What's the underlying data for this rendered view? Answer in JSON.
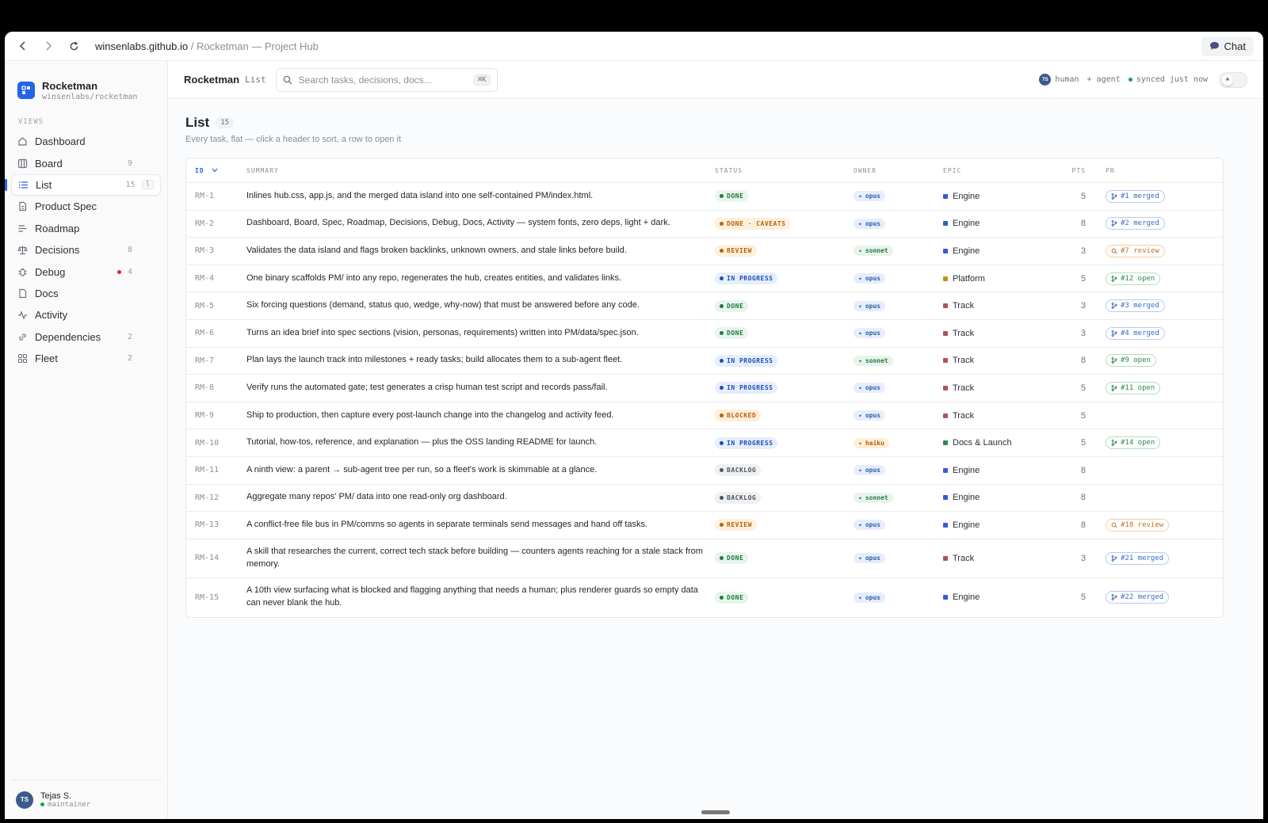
{
  "browser": {
    "host": "winsenlabs.github.io",
    "separator": "/",
    "title": "Rocketman — Project Hub",
    "chat_label": "Chat"
  },
  "sidebar": {
    "brand_name": "Rocketman",
    "brand_sub": "winsenlabs/rocketman",
    "views_label": "VIEWS",
    "items": [
      {
        "label": "Dashboard",
        "count": "",
        "icon": "home-icon"
      },
      {
        "label": "Board",
        "count": "9",
        "icon": "board-icon"
      },
      {
        "label": "List",
        "count": "15",
        "icon": "list-icon",
        "hint": "l"
      },
      {
        "label": "Product Spec",
        "count": "",
        "icon": "document-icon"
      },
      {
        "label": "Roadmap",
        "count": "",
        "icon": "roadmap-icon"
      },
      {
        "label": "Decisions",
        "count": "8",
        "icon": "scale-icon"
      },
      {
        "label": "Debug",
        "count": "4",
        "icon": "bug-icon"
      },
      {
        "label": "Docs",
        "count": "",
        "icon": "docs-icon"
      },
      {
        "label": "Activity",
        "count": "",
        "icon": "activity-icon"
      },
      {
        "label": "Dependencies",
        "count": "2",
        "icon": "link-icon"
      },
      {
        "label": "Fleet",
        "count": "2",
        "icon": "fleet-icon"
      }
    ],
    "user": {
      "initials": "TS",
      "name": "Tejas S.",
      "role": "maintainer"
    }
  },
  "topbar": {
    "app": "Rocketman",
    "view": "List",
    "search_placeholder": "Search tasks, decisions, docs...",
    "search_kbd": "⌘K",
    "human_initials": "TS",
    "human_label": "human",
    "agent_label": "+ agent",
    "sync_label": "synced just now"
  },
  "page": {
    "title": "List",
    "count": "15",
    "subtitle": "Every task, flat — click a header to sort, a row to open it"
  },
  "table": {
    "headers": {
      "id": "ID",
      "summary": "SUMMARY",
      "status": "STATUS",
      "owner": "OWNER",
      "epic": "EPIC",
      "pts": "PTS",
      "pr": "PR"
    },
    "rows": [
      {
        "id": "RM-1",
        "summary": "Inlines hub.css, app.js, and the merged data island into one self-contained PM/index.html.",
        "status": "DONE",
        "owner": "opus",
        "epic": "Engine",
        "pts": "5",
        "pr": "#1 merged"
      },
      {
        "id": "RM-2",
        "summary": "Dashboard, Board, Spec, Roadmap, Decisions, Debug, Docs, Activity — system fonts, zero deps, light + dark.",
        "status": "DONE · CAVEATS",
        "owner": "opus",
        "epic": "Engine",
        "pts": "8",
        "pr": "#2 merged"
      },
      {
        "id": "RM-3",
        "summary": "Validates the data island and flags broken backlinks, unknown owners, and stale links before build.",
        "status": "REVIEW",
        "owner": "sonnet",
        "epic": "Engine",
        "pts": "3",
        "pr": "#7 review"
      },
      {
        "id": "RM-4",
        "summary": "One binary scaffolds PM/ into any repo, regenerates the hub, creates entities, and validates links.",
        "status": "IN PROGRESS",
        "owner": "opus",
        "epic": "Platform",
        "pts": "5",
        "pr": "#12 open"
      },
      {
        "id": "RM-5",
        "summary": "Six forcing questions (demand, status quo, wedge, why-now) that must be answered before any code.",
        "status": "DONE",
        "owner": "opus",
        "epic": "Track",
        "pts": "3",
        "pr": "#3 merged"
      },
      {
        "id": "RM-6",
        "summary": "Turns an idea brief into spec sections (vision, personas, requirements) written into PM/data/spec.json.",
        "status": "DONE",
        "owner": "opus",
        "epic": "Track",
        "pts": "3",
        "pr": "#4 merged"
      },
      {
        "id": "RM-7",
        "summary": "Plan lays the launch track into milestones + ready tasks; build allocates them to a sub-agent fleet.",
        "status": "IN PROGRESS",
        "owner": "sonnet",
        "epic": "Track",
        "pts": "8",
        "pr": "#9 open"
      },
      {
        "id": "RM-8",
        "summary": "Verify runs the automated gate; test generates a crisp human test script and records pass/fail.",
        "status": "IN PROGRESS",
        "owner": "opus",
        "epic": "Track",
        "pts": "5",
        "pr": "#11 open"
      },
      {
        "id": "RM-9",
        "summary": "Ship to production, then capture every post-launch change into the changelog and activity feed.",
        "status": "BLOCKED",
        "owner": "opus",
        "epic": "Track",
        "pts": "5",
        "pr": ""
      },
      {
        "id": "RM-10",
        "summary": "Tutorial, how-tos, reference, and explanation — plus the OSS landing README for launch.",
        "status": "IN PROGRESS",
        "owner": "haiku",
        "epic": "Docs & Launch",
        "pts": "5",
        "pr": "#14 open"
      },
      {
        "id": "RM-11",
        "summary": "A ninth view: a parent → sub-agent tree per run, so a fleet's work is skimmable at a glance.",
        "status": "BACKLOG",
        "owner": "opus",
        "epic": "Engine",
        "pts": "8",
        "pr": ""
      },
      {
        "id": "RM-12",
        "summary": "Aggregate many repos' PM/ data into one read-only org dashboard.",
        "status": "BACKLOG",
        "owner": "sonnet",
        "epic": "Engine",
        "pts": "8",
        "pr": ""
      },
      {
        "id": "RM-13",
        "summary": "A conflict-free file bus in PM/comms so agents in separate terminals send messages and hand off tasks.",
        "status": "REVIEW",
        "owner": "opus",
        "epic": "Engine",
        "pts": "8",
        "pr": "#18 review"
      },
      {
        "id": "RM-14",
        "summary": "A skill that researches the current, correct tech stack before building — counters agents reaching for a stale stack from memory.",
        "status": "DONE",
        "owner": "opus",
        "epic": "Track",
        "pts": "3",
        "pr": "#21 merged"
      },
      {
        "id": "RM-15",
        "summary": "A 10th view surfacing what is blocked and flagging anything that needs a human; plus renderer guards so empty data can never blank the hub.",
        "status": "DONE",
        "owner": "opus",
        "epic": "Engine",
        "pts": "5",
        "pr": "#22 merged"
      }
    ]
  },
  "colors": {
    "accent": "#2563eb",
    "epic_engine": "#2f5fd0",
    "epic_platform": "#c98a1a",
    "epic_track": "#b4505a",
    "epic_docs": "#2e8a4c"
  }
}
